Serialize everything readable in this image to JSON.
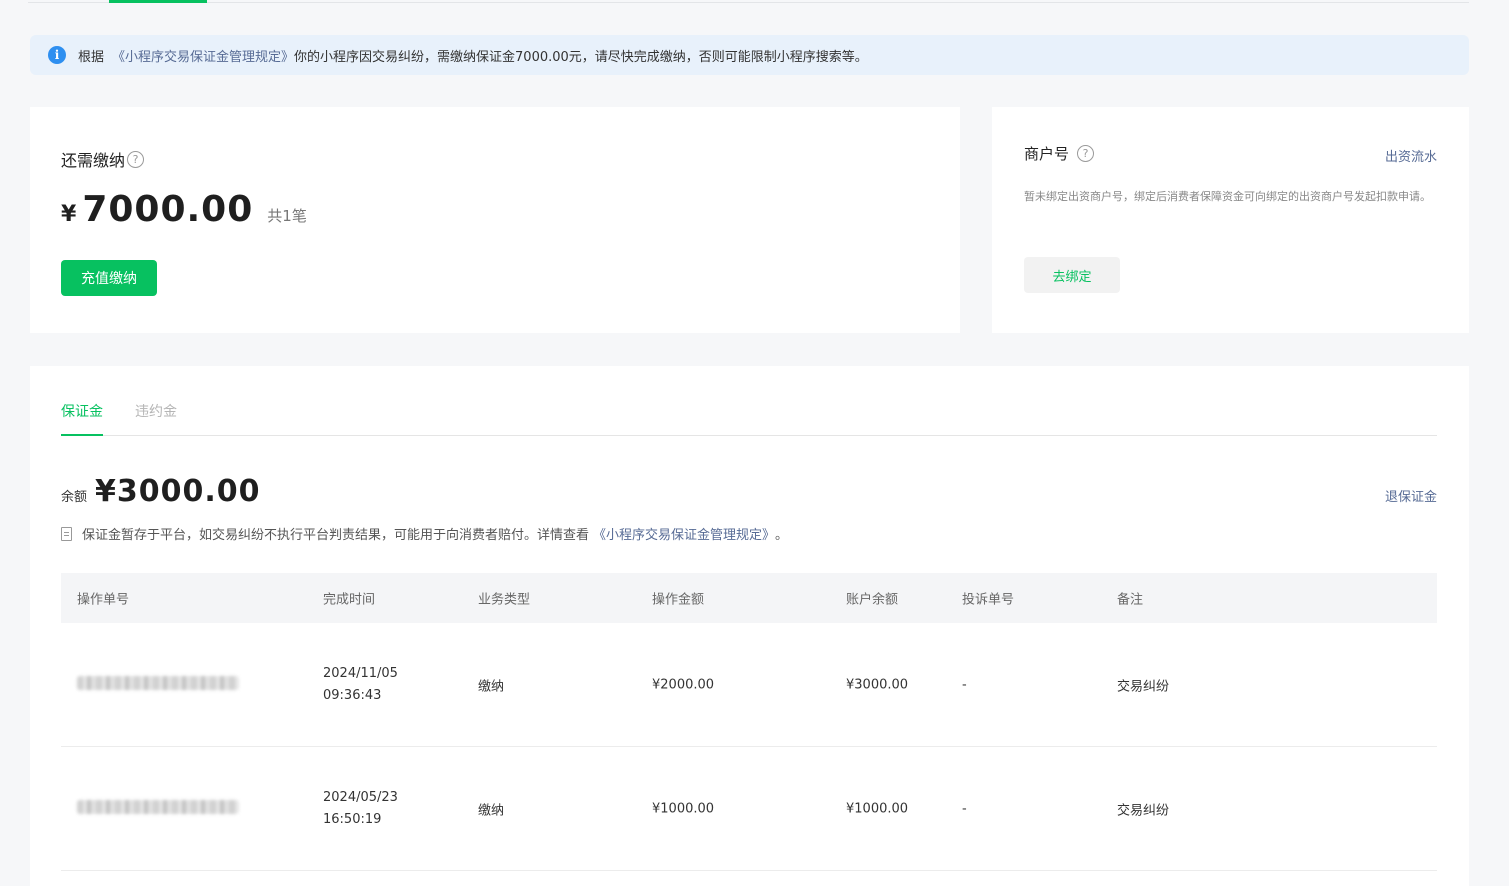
{
  "notice": {
    "prefix": "根据",
    "link": "《小程序交易保证金管理规定》",
    "text": "你的小程序因交易纠纷，需缴纳保证金7000.00元，请尽快完成缴纳，否则可能限制小程序搜索等。"
  },
  "due": {
    "title": "还需缴纳",
    "currency": "¥",
    "amount": "7000.00",
    "count": "共1笔",
    "pay_button": "充值缴纳"
  },
  "merchant": {
    "title": "商户号",
    "flow_link": "出资流水",
    "description": "暂未绑定出资商户号，绑定后消费者保障资金可向绑定的出资商户号发起扣款申请。",
    "bind_button": "去绑定"
  },
  "tabs": [
    {
      "label": "保证金",
      "active": true
    },
    {
      "label": "违约金",
      "active": false
    }
  ],
  "balance": {
    "label": "余额",
    "amount": "¥3000.00",
    "refund_link": "退保证金",
    "note": "保证金暂存于平台，如交易纠纷不执行平台判责结果，可能用于向消费者赔付。详情查看",
    "note_link": "《小程序交易保证金管理规定》",
    "note_suffix": "。"
  },
  "table": {
    "headers": [
      "操作单号",
      "完成时间",
      "业务类型",
      "操作金额",
      "账户余额",
      "投诉单号",
      "备注"
    ],
    "rows": [
      {
        "id": "",
        "date": "2024/11/05",
        "time": "09:36:43",
        "type": "缴纳",
        "amount": "¥2000.00",
        "balance": "¥3000.00",
        "complaint": "-",
        "note": "交易纠纷"
      },
      {
        "id": "",
        "date": "2024/05/23",
        "time": "16:50:19",
        "type": "缴纳",
        "amount": "¥1000.00",
        "balance": "¥1000.00",
        "complaint": "-",
        "note": "交易纠纷"
      }
    ]
  },
  "icons": {
    "info": "info-icon",
    "help": "question-circle-icon",
    "doc": "document-icon"
  },
  "colors": {
    "accent": "#07c160",
    "link": "#576b95",
    "info": "#2e8ff0"
  }
}
